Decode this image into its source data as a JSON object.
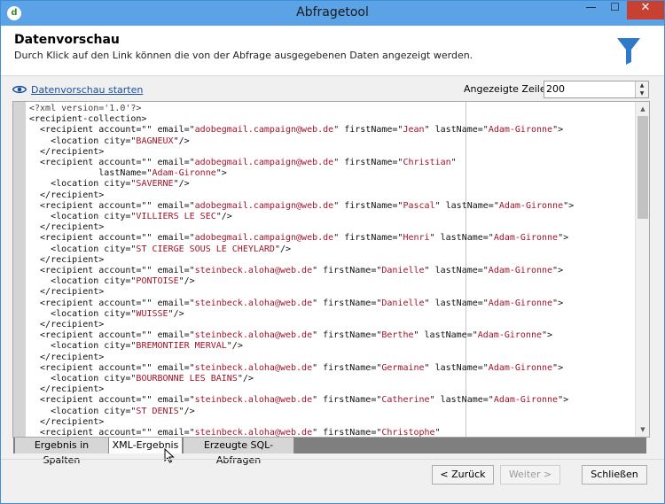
{
  "window": {
    "title": "Abfragetool",
    "app_icon_glyph": "d",
    "minimize_glyph": "—",
    "maximize_glyph": "☐",
    "close_glyph": "✕"
  },
  "header": {
    "title": "Datenvorschau",
    "subtitle": "Durch Klick auf den Link können die von der Abfrage ausgegebenen Daten angezeigt werden.",
    "icon": "funnel-icon"
  },
  "toolbar": {
    "preview_link": "Datenvorschau starten",
    "rows_label": "Angezeigte Zeilen:",
    "rows_value": "200"
  },
  "xml_lines": [
    [
      {
        "c": "pi",
        "t": "<?xml version='1.0'?>"
      }
    ],
    [
      {
        "c": "t",
        "t": "<recipient-collection>"
      }
    ],
    [
      {
        "c": "t",
        "t": "  <recipient account=\"\" email=\""
      },
      {
        "c": "s",
        "t": "adobegmail.campaign@web.de"
      },
      {
        "c": "t",
        "t": "\" firstName=\""
      },
      {
        "c": "s",
        "t": "Jean"
      },
      {
        "c": "t",
        "t": "\" lastName=\""
      },
      {
        "c": "s",
        "t": "Adam-Gironne"
      },
      {
        "c": "t",
        "t": "\">"
      }
    ],
    [
      {
        "c": "t",
        "t": "    <location city=\""
      },
      {
        "c": "s",
        "t": "BAGNEUX"
      },
      {
        "c": "t",
        "t": "\"/>"
      }
    ],
    [
      {
        "c": "t",
        "t": "  </recipient>"
      }
    ],
    [
      {
        "c": "t",
        "t": "  <recipient account=\"\" email=\""
      },
      {
        "c": "s",
        "t": "adobegmail.campaign@web.de"
      },
      {
        "c": "t",
        "t": "\" firstName=\""
      },
      {
        "c": "s",
        "t": "Christian"
      },
      {
        "c": "t",
        "t": "\""
      }
    ],
    [
      {
        "c": "t",
        "t": "             lastName=\""
      },
      {
        "c": "s",
        "t": "Adam-Gironne"
      },
      {
        "c": "t",
        "t": "\">"
      }
    ],
    [
      {
        "c": "t",
        "t": "    <location city=\""
      },
      {
        "c": "s",
        "t": "SAVERNE"
      },
      {
        "c": "t",
        "t": "\"/>"
      }
    ],
    [
      {
        "c": "t",
        "t": "  </recipient>"
      }
    ],
    [
      {
        "c": "t",
        "t": "  <recipient account=\"\" email=\""
      },
      {
        "c": "s",
        "t": "adobegmail.campaign@web.de"
      },
      {
        "c": "t",
        "t": "\" firstName=\""
      },
      {
        "c": "s",
        "t": "Pascal"
      },
      {
        "c": "t",
        "t": "\" lastName=\""
      },
      {
        "c": "s",
        "t": "Adam-Gironne"
      },
      {
        "c": "t",
        "t": "\">"
      }
    ],
    [
      {
        "c": "t",
        "t": "    <location city=\""
      },
      {
        "c": "s",
        "t": "VILLIERS LE SEC"
      },
      {
        "c": "t",
        "t": "\"/>"
      }
    ],
    [
      {
        "c": "t",
        "t": "  </recipient>"
      }
    ],
    [
      {
        "c": "t",
        "t": "  <recipient account=\"\" email=\""
      },
      {
        "c": "s",
        "t": "adobegmail.campaign@web.de"
      },
      {
        "c": "t",
        "t": "\" firstName=\""
      },
      {
        "c": "s",
        "t": "Henri"
      },
      {
        "c": "t",
        "t": "\" lastName=\""
      },
      {
        "c": "s",
        "t": "Adam-Gironne"
      },
      {
        "c": "t",
        "t": "\">"
      }
    ],
    [
      {
        "c": "t",
        "t": "    <location city=\""
      },
      {
        "c": "s",
        "t": "ST CIERGE SOUS LE CHEYLARD"
      },
      {
        "c": "t",
        "t": "\"/>"
      }
    ],
    [
      {
        "c": "t",
        "t": "  </recipient>"
      }
    ],
    [
      {
        "c": "t",
        "t": "  <recipient account=\"\" email=\""
      },
      {
        "c": "s",
        "t": "steinbeck.aloha@web.de"
      },
      {
        "c": "t",
        "t": "\" firstName=\""
      },
      {
        "c": "s",
        "t": "Danielle"
      },
      {
        "c": "t",
        "t": "\" lastName=\""
      },
      {
        "c": "s",
        "t": "Adam-Gironne"
      },
      {
        "c": "t",
        "t": "\">"
      }
    ],
    [
      {
        "c": "t",
        "t": "    <location city=\""
      },
      {
        "c": "s",
        "t": "PONTOISE"
      },
      {
        "c": "t",
        "t": "\"/>"
      }
    ],
    [
      {
        "c": "t",
        "t": "  </recipient>"
      }
    ],
    [
      {
        "c": "t",
        "t": "  <recipient account=\"\" email=\""
      },
      {
        "c": "s",
        "t": "steinbeck.aloha@web.de"
      },
      {
        "c": "t",
        "t": "\" firstName=\""
      },
      {
        "c": "s",
        "t": "Danielle"
      },
      {
        "c": "t",
        "t": "\" lastName=\""
      },
      {
        "c": "s",
        "t": "Adam-Gironne"
      },
      {
        "c": "t",
        "t": "\">"
      }
    ],
    [
      {
        "c": "t",
        "t": "    <location city=\""
      },
      {
        "c": "s",
        "t": "WUISSE"
      },
      {
        "c": "t",
        "t": "\"/>"
      }
    ],
    [
      {
        "c": "t",
        "t": "  </recipient>"
      }
    ],
    [
      {
        "c": "t",
        "t": "  <recipient account=\"\" email=\""
      },
      {
        "c": "s",
        "t": "steinbeck.aloha@web.de"
      },
      {
        "c": "t",
        "t": "\" firstName=\""
      },
      {
        "c": "s",
        "t": "Berthe"
      },
      {
        "c": "t",
        "t": "\" lastName=\""
      },
      {
        "c": "s",
        "t": "Adam-Gironne"
      },
      {
        "c": "t",
        "t": "\">"
      }
    ],
    [
      {
        "c": "t",
        "t": "    <location city=\""
      },
      {
        "c": "s",
        "t": "BREMONTIER MERVAL"
      },
      {
        "c": "t",
        "t": "\"/>"
      }
    ],
    [
      {
        "c": "t",
        "t": "  </recipient>"
      }
    ],
    [
      {
        "c": "t",
        "t": "  <recipient account=\"\" email=\""
      },
      {
        "c": "s",
        "t": "steinbeck.aloha@web.de"
      },
      {
        "c": "t",
        "t": "\" firstName=\""
      },
      {
        "c": "s",
        "t": "Germaine"
      },
      {
        "c": "t",
        "t": "\" lastName=\""
      },
      {
        "c": "s",
        "t": "Adam-Gironne"
      },
      {
        "c": "t",
        "t": "\">"
      }
    ],
    [
      {
        "c": "t",
        "t": "    <location city=\""
      },
      {
        "c": "s",
        "t": "BOURBONNE LES BAINS"
      },
      {
        "c": "t",
        "t": "\"/>"
      }
    ],
    [
      {
        "c": "t",
        "t": "  </recipient>"
      }
    ],
    [
      {
        "c": "t",
        "t": "  <recipient account=\"\" email=\""
      },
      {
        "c": "s",
        "t": "steinbeck.aloha@web.de"
      },
      {
        "c": "t",
        "t": "\" firstName=\""
      },
      {
        "c": "s",
        "t": "Catherine"
      },
      {
        "c": "t",
        "t": "\" lastName=\""
      },
      {
        "c": "s",
        "t": "Adam-Gironne"
      },
      {
        "c": "t",
        "t": "\">"
      }
    ],
    [
      {
        "c": "t",
        "t": "    <location city=\""
      },
      {
        "c": "s",
        "t": "ST DENIS"
      },
      {
        "c": "t",
        "t": "\"/>"
      }
    ],
    [
      {
        "c": "t",
        "t": "  </recipient>"
      }
    ],
    [
      {
        "c": "t",
        "t": "  <recipient account=\"\" email=\""
      },
      {
        "c": "s",
        "t": "steinbeck.aloha@web.de"
      },
      {
        "c": "t",
        "t": "\" firstName=\""
      },
      {
        "c": "s",
        "t": "Christophe"
      },
      {
        "c": "t",
        "t": "\""
      }
    ]
  ],
  "tabs": [
    "Ergebnis in Spalten",
    "XML-Ergebnis",
    "Erzeugte SQL-Abfragen"
  ],
  "active_tab": "XML-Ergebnis",
  "buttons": {
    "back": "< Zurück",
    "next": "Weiter >",
    "close": "Schließen"
  },
  "colors": {
    "titlebar": "#5ba3e6",
    "close_button": "#c84031",
    "funnel": "#2f7ac8",
    "xml_value": "#a0142a",
    "link": "#1a4fa0"
  }
}
